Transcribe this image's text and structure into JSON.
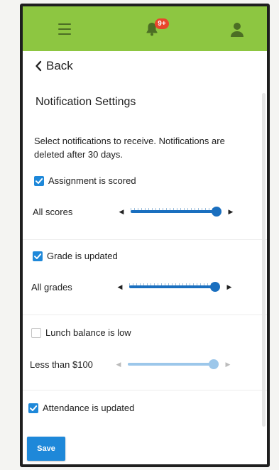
{
  "header": {
    "badge": "9+",
    "color": "#8dc641"
  },
  "nav": {
    "back_label": "Back"
  },
  "page": {
    "title": "Notification Settings",
    "intro": "Select notifications to receive. Notifications are deleted after 30 days."
  },
  "settings": [
    {
      "label": "Assignment is scored",
      "checked": true,
      "slider_label": "All scores",
      "slider_value": 1.0,
      "enabled": true
    },
    {
      "label": "Grade is updated",
      "checked": true,
      "slider_label": "All grades",
      "slider_value": 1.0,
      "enabled": true
    },
    {
      "label": "Lunch balance is low",
      "checked": false,
      "slider_label": "Less than $100",
      "slider_value": 1.0,
      "enabled": false
    },
    {
      "label": "Attendance is updated",
      "checked": true
    }
  ],
  "actions": {
    "save_label": "Save",
    "accent": "#1e88d9"
  }
}
